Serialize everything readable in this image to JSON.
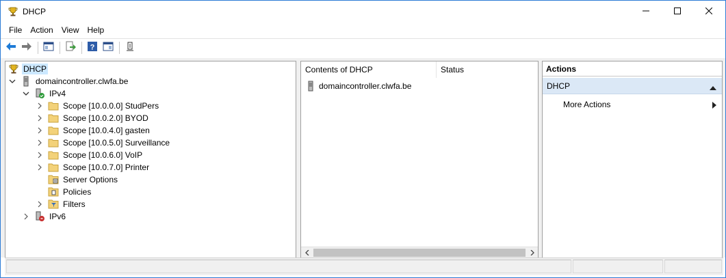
{
  "window": {
    "title": "DHCP",
    "app_icon": "trophy-icon",
    "controls": [
      "minimize-icon",
      "maximize-icon",
      "close-icon"
    ]
  },
  "menu": {
    "items": [
      "File",
      "Action",
      "View",
      "Help"
    ]
  },
  "toolbar": {
    "buttons": [
      "back-arrow-icon",
      "forward-arrow-icon",
      "show-hide-tree-icon",
      "export-list-icon",
      "help-icon",
      "show-hide-action-pane-icon",
      "filter-icon"
    ]
  },
  "tree": {
    "root": {
      "label": "DHCP",
      "icon": "trophy-icon",
      "selected": true
    },
    "server": {
      "label": "domaincontroller.clwfa.be",
      "icon": "server-icon",
      "expanded": true
    },
    "ipv4": {
      "label": "IPv4",
      "icon": "server-ipv4-icon",
      "expanded": true
    },
    "scopes": [
      "Scope [10.0.0.0] StudPers",
      "Scope [10.0.2.0] BYOD",
      "Scope [10.0.4.0] gasten",
      "Scope [10.0.5.0] Surveillance",
      "Scope [10.0.6.0] VoIP",
      "Scope [10.0.7.0] Printer"
    ],
    "server_options": "Server Options",
    "policies": "Policies",
    "filters": "Filters",
    "ipv6": {
      "label": "IPv6",
      "icon": "server-ipv6-icon",
      "expanded": false
    }
  },
  "content": {
    "columns": [
      "Contents of DHCP",
      "Status"
    ],
    "rows": [
      {
        "name": "domaincontroller.clwfa.be",
        "status": ""
      }
    ]
  },
  "actions": {
    "header": "Actions",
    "group": "DHCP",
    "items": [
      "More Actions"
    ]
  },
  "colors": {
    "selection": "#cce8ff",
    "action_group_bg": "#dbe8f6",
    "window_border": "#2b7bd6",
    "back_arrow": "#1e7bd7"
  }
}
